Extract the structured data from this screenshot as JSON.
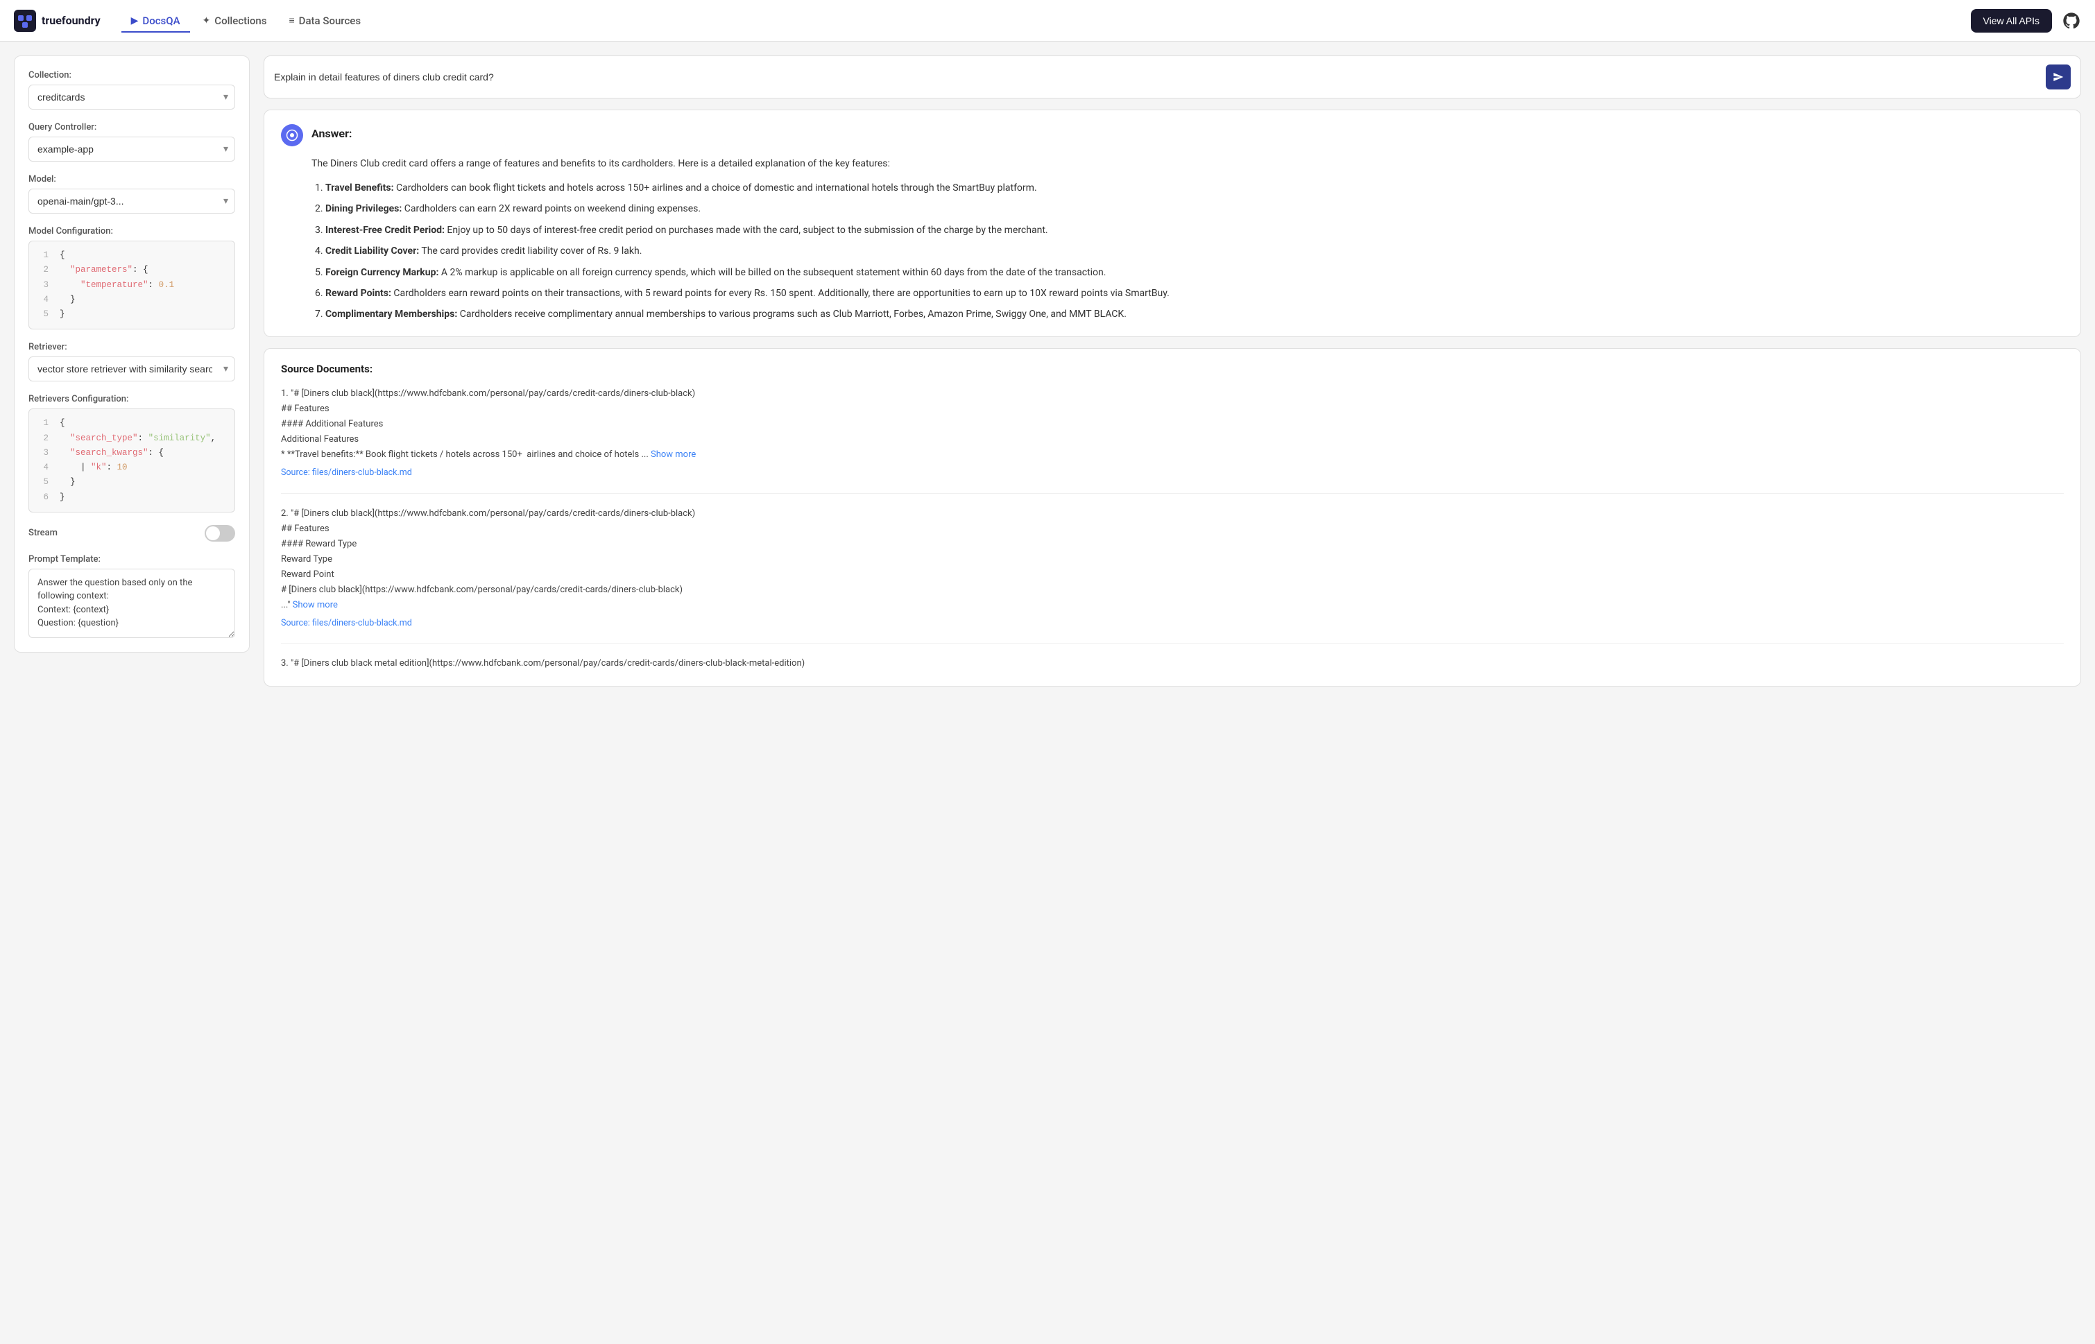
{
  "header": {
    "logo_text": "truefoundry",
    "nav_items": [
      {
        "label": "DocsQA",
        "active": true,
        "icon": "▶"
      },
      {
        "label": "Collections",
        "active": false,
        "icon": "✦"
      },
      {
        "label": "Data Sources",
        "active": false,
        "icon": "≡"
      }
    ],
    "view_all_apis_label": "View All APIs"
  },
  "sidebar": {
    "collection_label": "Collection:",
    "collection_value": "creditcards",
    "collection_options": [
      "creditcards"
    ],
    "query_controller_label": "Query Controller:",
    "query_controller_value": "example-app",
    "query_controller_options": [
      "example-app"
    ],
    "model_label": "Model:",
    "model_value": "openai-main/gpt-3...",
    "model_options": [
      "openai-main/gpt-3..."
    ],
    "model_config_label": "Model Configuration:",
    "model_config_lines": [
      {
        "num": 1,
        "content": "{"
      },
      {
        "num": 2,
        "content": "  \"parameters\": {",
        "has_key": true,
        "key": "\"parameters\"",
        "colon": ": {"
      },
      {
        "num": 3,
        "content": "    \"temperature\": 0.1",
        "has_key": true,
        "key": "\"temperature\"",
        "colon": ": ",
        "val": "0.1",
        "val_type": "num"
      },
      {
        "num": 4,
        "content": "  }"
      },
      {
        "num": 5,
        "content": "}"
      }
    ],
    "retriever_label": "Retriever:",
    "retriever_value": "vector store retriever with similarity search",
    "retriever_options": [
      "vector store retriever with similarity search"
    ],
    "retrievers_config_label": "Retrievers Configuration:",
    "retrievers_config_lines": [
      {
        "num": 1,
        "content": "{"
      },
      {
        "num": 2,
        "content": "  \"search_type\": \"similarity\","
      },
      {
        "num": 3,
        "content": "  \"search_kwargs\": {"
      },
      {
        "num": 4,
        "content": "    \"k\": 10"
      },
      {
        "num": 5,
        "content": "  }"
      },
      {
        "num": 6,
        "content": "}"
      }
    ],
    "stream_label": "Stream",
    "stream_on": false,
    "prompt_template_label": "Prompt Template:",
    "prompt_template_value": "Answer the question based only on the following context:\nContext: {context}\nQuestion: {question}"
  },
  "query": {
    "placeholder": "Explain in detail features of diners club credit card?",
    "value": "Explain in detail features of diners club credit card?",
    "send_icon": "▶"
  },
  "answer": {
    "title": "Answer:",
    "intro": "The Diners Club credit card offers a range of features and benefits to its cardholders. Here is a detailed explanation of the key features:",
    "items": [
      {
        "bold": "Travel Benefits:",
        "text": " Cardholders can book flight tickets and hotels across 150+ airlines and a choice of domestic and international hotels through the SmartBuy platform."
      },
      {
        "bold": "Dining Privileges:",
        "text": " Cardholders can earn 2X reward points on weekend dining expenses."
      },
      {
        "bold": "Interest-Free Credit Period:",
        "text": " Enjoy up to 50 days of interest-free credit period on purchases made with the card, subject to the submission of the charge by the merchant."
      },
      {
        "bold": "Credit Liability Cover:",
        "text": " The card provides credit liability cover of Rs. 9 lakh."
      },
      {
        "bold": "Foreign Currency Markup:",
        "text": " A 2% markup is applicable on all foreign currency spends, which will be billed on the subsequent statement within 60 days from the date of the transaction."
      },
      {
        "bold": "Reward Points:",
        "text": " Cardholders earn reward points on their transactions, with 5 reward points for every Rs. 150 spent. Additionally, there are opportunities to earn up to 10X reward points via SmartBuy."
      },
      {
        "bold": "Complimentary Memberships:",
        "text": " Cardholders receive complimentary annual memberships to various programs such as Club Marriott, Forbes, Amazon Prime, Swiggy One, and MMT BLACK."
      }
    ]
  },
  "source_docs": {
    "title": "Source Documents:",
    "docs": [
      {
        "num": 1,
        "lines": [
          "\"# [Diners club black](https://www.hdfcbank.com/personal/pay/cards/credit-cards/diners-club-black)",
          "## Features",
          "#### Additional Features",
          "Additional Features",
          "* **Travel benefits:** Book flight tickets / hotels across 150+  airlines and choice of hotels ..."
        ],
        "show_more": true,
        "show_more_label": "Show more",
        "source_label": "Source: files/diners-club-black.md"
      },
      {
        "num": 2,
        "lines": [
          "\"# [Diners club black](https://www.hdfcbank.com/personal/pay/cards/credit-cards/diners-club-black)",
          "## Features",
          "#### Reward Type",
          "Reward Type",
          "Reward Point",
          "# [Diners club black](https://www.hdfcbank.com/personal/pay/cards/credit-cards/diners-club-black)",
          "..."
        ],
        "show_more": true,
        "show_more_label": "Show more",
        "source_label": "Source: files/diners-club-black.md"
      },
      {
        "num": 3,
        "lines": [
          "\"# [Diners club black metal edition](https://www.hdfcbank.com/personal/pay/cards/credit-cards/diners-club-black-metal-edition)"
        ],
        "show_more": false,
        "source_label": ""
      }
    ]
  }
}
